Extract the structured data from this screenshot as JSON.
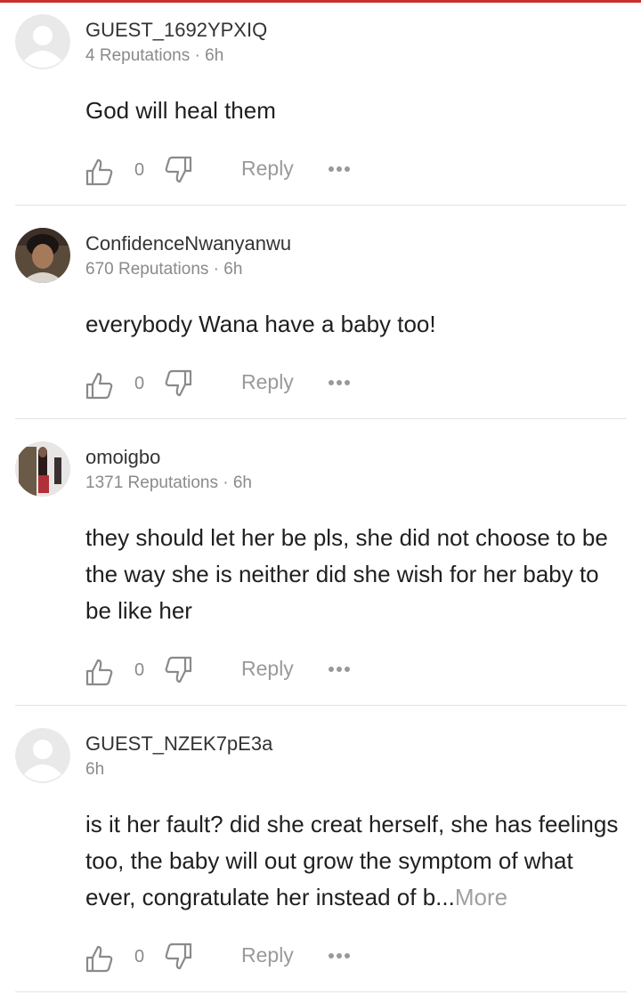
{
  "comments": [
    {
      "username": "GUEST_1692YPXIQ",
      "meta": "4 Reputations · 6h",
      "text": "God will heal them",
      "more": "",
      "likes": "0",
      "reply_label": "Reply",
      "avatar": "default-avatar"
    },
    {
      "username": "ConfidenceNwanyanwu",
      "meta": "670 Reputations · 6h",
      "text": "everybody Wana have a baby too!",
      "more": "",
      "likes": "0",
      "reply_label": "Reply",
      "avatar": "photo-avatar"
    },
    {
      "username": "omoigbo",
      "meta": "1371 Reputations · 6h",
      "text": "they should let her be pls, she did not choose to be the way she is neither did she wish for her baby to be like her",
      "more": "",
      "likes": "0",
      "reply_label": "Reply",
      "avatar": "photo-avatar"
    },
    {
      "username": "GUEST_NZEK7pE3a",
      "meta": "6h",
      "text": "is it her fault? did she creat herself, she has feelings too, the baby will out grow the symptom of what ever, congratulate her instead of b...",
      "more": "More",
      "likes": "0",
      "reply_label": "Reply",
      "avatar": "default-avatar"
    }
  ],
  "colors": {
    "accent": "#c9302c",
    "muted": "#8a8a8a",
    "divider": "#e3e3e3"
  }
}
